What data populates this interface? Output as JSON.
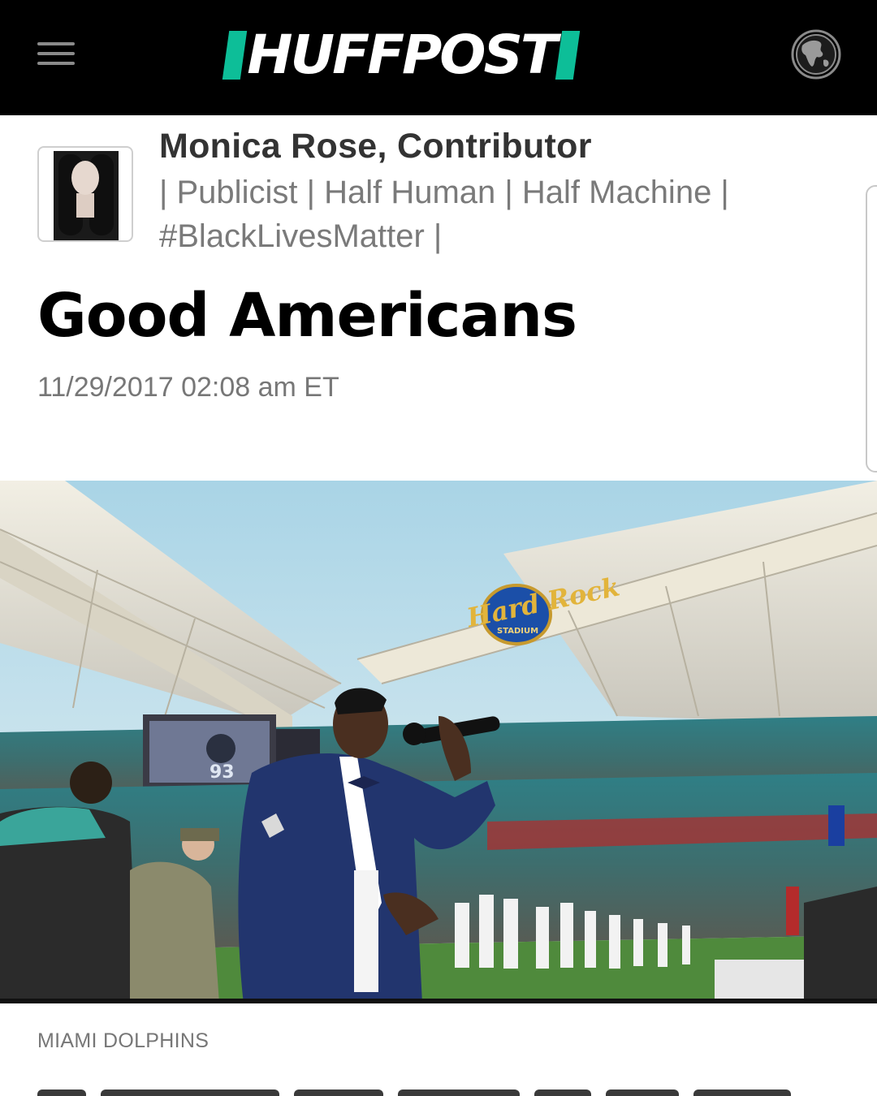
{
  "header": {
    "menu_icon": "hamburger-menu-icon",
    "logo_text": "HUFFPOST",
    "brand_color": "#0dbe98",
    "edition_icon": "globe-icon"
  },
  "author": {
    "name": "Monica Rose, Contributor",
    "bio": "| Publicist | Half Human | Half Machine | #BlackLivesMatter |"
  },
  "article": {
    "title": "Good Americans",
    "timestamp": "11/29/2017 02:08 am ET",
    "image_credit": "MIAMI DOLPHINS"
  },
  "photo": {
    "stadium_sign": "Hard Rock",
    "stadium_sign_sub": "STADIUM",
    "jersey_number": "93"
  }
}
